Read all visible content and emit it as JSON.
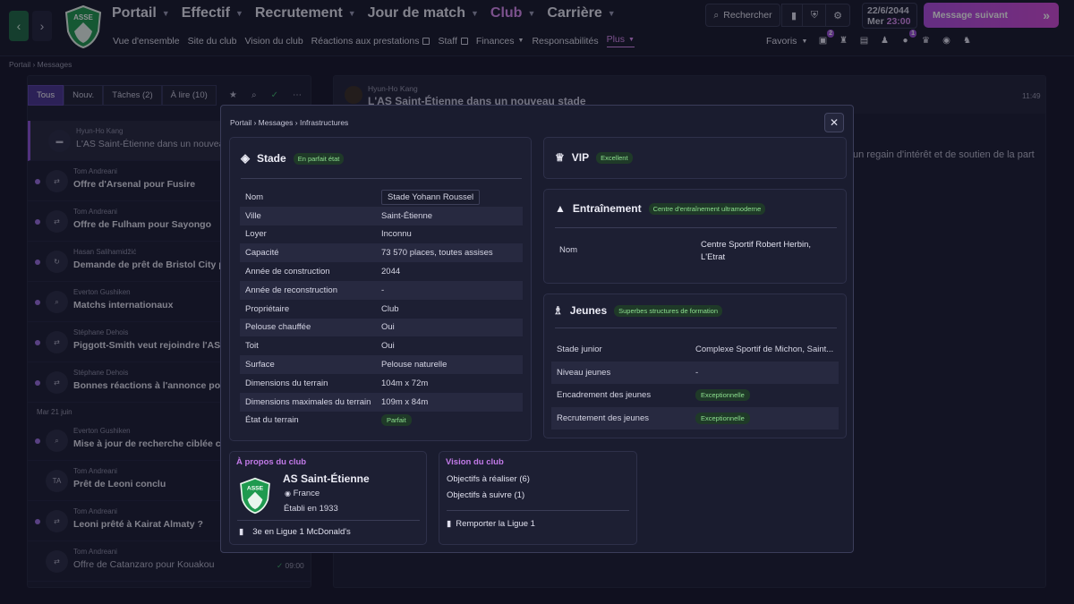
{
  "header": {
    "main_nav": [
      {
        "label": "Portail"
      },
      {
        "label": "Effectif"
      },
      {
        "label": "Recrutement"
      },
      {
        "label": "Jour de match"
      },
      {
        "label": "Club"
      },
      {
        "label": "Carrière"
      }
    ],
    "sub_nav": [
      {
        "label": "Vue d'ensemble"
      },
      {
        "label": "Site du club"
      },
      {
        "label": "Vision du club"
      },
      {
        "label": "Réactions aux prestations"
      },
      {
        "label": "Staff"
      },
      {
        "label": "Finances"
      },
      {
        "label": "Responsabilités"
      },
      {
        "label": "Plus"
      }
    ],
    "search_label": "Rechercher",
    "date": "22/6/2044",
    "day": "Mer",
    "time": "23:00",
    "next_message": "Message suivant",
    "favorites": "Favoris",
    "badge_1": "2",
    "badge_2": "1",
    "logo_text": "ASSE"
  },
  "page_breadcrumb": {
    "a": "Portail",
    "b": "Messages"
  },
  "inbox": {
    "filters": [
      {
        "label": "Tous"
      },
      {
        "label": "Nouv."
      },
      {
        "label": "Tâches (2)"
      },
      {
        "label": "À lire (10)"
      }
    ],
    "messages": [
      {
        "from": "Hyun-Ho Kang",
        "subject": "L'AS Saint-Étienne dans un nouveau sta"
      },
      {
        "from": "Tom Andreani",
        "subject": "Offre d'Arsenal pour Fusire"
      },
      {
        "from": "Tom Andreani",
        "subject": "Offre de Fulham pour Sayongo"
      },
      {
        "from": "Hasan Salihamidžić",
        "subject": "Demande de prêt de Bristol City po"
      },
      {
        "from": "Everton Gushiken",
        "subject": "Matchs internationaux"
      },
      {
        "from": "Stéphane Dehois",
        "subject": "Piggott-Smith veut rejoindre l'AS S"
      },
      {
        "from": "Stéphane Dehois",
        "subject": "Bonnes réactions à l'annonce pour"
      }
    ],
    "date_separator": "Mar 21 juin",
    "messages2": [
      {
        "from": "Everton Gushiken",
        "subject": "Mise à jour de recherche ciblée con"
      },
      {
        "from": "Tom Andreani",
        "subject": "Prêt de Leoni conclu",
        "avatar": "TA"
      },
      {
        "from": "Tom Andreani",
        "subject": "Leoni prêté à Kairat Almaty ?"
      },
      {
        "from": "Tom Andreani",
        "subject": "Offre de Catanzaro pour Kouakou",
        "time": "09:00"
      }
    ]
  },
  "reader": {
    "from": "Hyun-Ho Kang",
    "subject": "L'AS Saint-Étienne dans un nouveau stade",
    "time": "11:49",
    "body": "un regain d'intérêt et de soutien de la part"
  },
  "modal": {
    "breadcrumb": {
      "a": "Portail",
      "b": "Messages",
      "c": "Infrastructures"
    },
    "stade": {
      "title": "Stade",
      "tag": "En parfait état",
      "rows": [
        {
          "k": "Nom",
          "v": "Stade Yohann Roussel"
        },
        {
          "k": "Ville",
          "v": "Saint-Étienne"
        },
        {
          "k": "Loyer",
          "v": "Inconnu"
        },
        {
          "k": "Capacité",
          "v": "73 570 places, toutes assises"
        },
        {
          "k": "Année de construction",
          "v": "2044"
        },
        {
          "k": "Année de reconstruction",
          "v": "-"
        },
        {
          "k": "Propriétaire",
          "v": "Club"
        },
        {
          "k": "Pelouse chauffée",
          "v": "Oui"
        },
        {
          "k": "Toit",
          "v": "Oui"
        },
        {
          "k": "Surface",
          "v": "Pelouse naturelle"
        },
        {
          "k": "Dimensions du terrain",
          "v": "104m x 72m"
        },
        {
          "k": "Dimensions maximales du terrain",
          "v": "109m x 84m"
        },
        {
          "k": "État du terrain",
          "v": "Parfait"
        }
      ]
    },
    "vip": {
      "title": "VIP",
      "tag": "Excellent"
    },
    "training": {
      "title": "Entraînement",
      "tag": "Centre d'entraînement ultramoderne",
      "name_label": "Nom",
      "name_value": "Centre Sportif Robert Herbin, L'Etrat"
    },
    "youth": {
      "title": "Jeunes",
      "tag": "Superbes structures de formation",
      "rows": [
        {
          "k": "Stade junior",
          "v": "Complexe Sportif de Michon, Saint..."
        },
        {
          "k": "Niveau jeunes",
          "v": "-"
        },
        {
          "k": "Encadrement des jeunes",
          "v": "Exceptionnelle"
        },
        {
          "k": "Recrutement des jeunes",
          "v": "Exceptionnelle"
        }
      ]
    },
    "about": {
      "title": "À propos du club",
      "club": "AS Saint-Étienne",
      "country": "France",
      "founded": "Établi en 1933",
      "league_pos": "3e en Ligue 1 McDonald's"
    },
    "vision": {
      "title": "Vision du club",
      "obj1_label": "Objectifs à réaliser",
      "obj1_count": "(6)",
      "obj2_label": "Objectifs à suivre",
      "obj2_count": "(1)",
      "goal": "Remporter la Ligue 1"
    }
  },
  "colors": {
    "accent": "#d98cf0",
    "brand_green": "#1f9a4f",
    "tag_green": "#8de08f"
  }
}
